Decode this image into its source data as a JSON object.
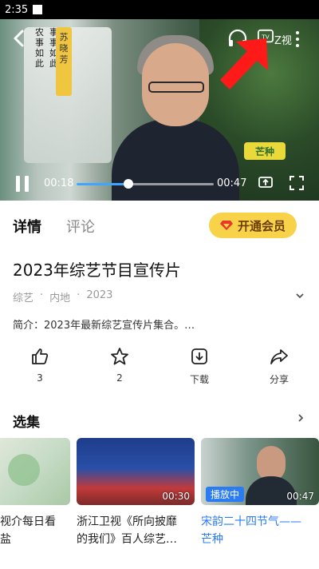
{
  "status_bar": {
    "time": "2:35"
  },
  "video": {
    "current_time": "00:18",
    "duration": "00:47",
    "progress_fraction": 0.38,
    "left_caption_1": "农事如此",
    "left_caption_2": "事事如此",
    "name_banner": "苏晓芳",
    "badge": "芒种",
    "tv_logo_text": "Z视",
    "icons": [
      "back-icon",
      "headphones-icon",
      "tv-logo-icon",
      "more-icon",
      "pause-icon",
      "cast-icon",
      "fullscreen-icon"
    ]
  },
  "tabs": [
    {
      "label": "详情",
      "active": true
    },
    {
      "label": "评论",
      "active": false
    }
  ],
  "vip_button": {
    "label": "开通会员"
  },
  "program": {
    "title": "2023年综艺节目宣传片",
    "meta": [
      "综艺",
      "·",
      "内地",
      "·",
      "2023"
    ],
    "description": "简介：2023年最新综艺宣传片集合。…"
  },
  "actions": [
    {
      "icon": "thumbs-up-icon",
      "label": "3"
    },
    {
      "icon": "star-icon",
      "label": "2"
    },
    {
      "icon": "download-icon",
      "label": "下载"
    },
    {
      "icon": "share-icon",
      "label": "分享"
    }
  ],
  "episodes_section": {
    "title": "选集"
  },
  "episodes": [
    {
      "caption": "视介每日看\n盐",
      "duration": "",
      "playing": false
    },
    {
      "caption": "浙江卫视《所向披靡\n的我们》百人综艺…",
      "duration": "00:30",
      "playing": false
    },
    {
      "caption": "宋韵二十四节气——\n芒种",
      "duration": "00:47",
      "playing": true,
      "badge": "播放中"
    }
  ],
  "colors": {
    "accent": "#2b7bf2",
    "vip": "#f8d34a",
    "arrow": "#ff1a1a"
  }
}
